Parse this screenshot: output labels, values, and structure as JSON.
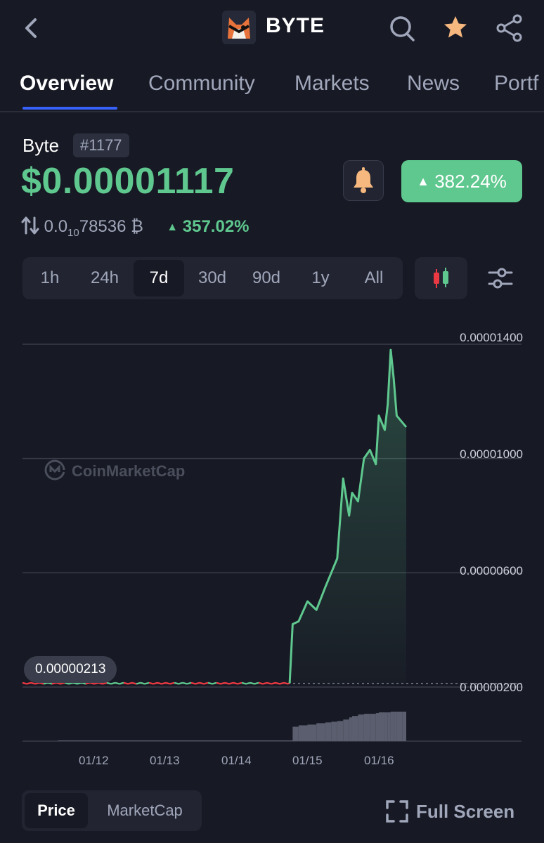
{
  "header": {
    "title": "BYTE",
    "back_icon": "chevron-left-icon",
    "search_icon": "search-icon",
    "star_icon": "star-icon",
    "share_icon": "share-icon",
    "star_color": "#f6b87e"
  },
  "tabs": [
    {
      "label": "Overview",
      "active": true
    },
    {
      "label": "Community",
      "active": false
    },
    {
      "label": "Markets",
      "active": false
    },
    {
      "label": "News",
      "active": false
    },
    {
      "label": "Portf",
      "active": false
    }
  ],
  "coin": {
    "name": "Byte",
    "rank": "#1177",
    "price": "$0.00001117",
    "change_24h": "382.24%",
    "btc_price_prefix": "0.0",
    "btc_price_subscript": "10",
    "btc_price_suffix": "78536 ₿",
    "btc_change": "357.02%"
  },
  "colors": {
    "up": "#5fc88f",
    "down": "#ea3943",
    "accent": "#3861fb",
    "bell": "#f6b87e"
  },
  "range": {
    "options": [
      "1h",
      "24h",
      "7d",
      "30d",
      "90d",
      "1y",
      "All"
    ],
    "selected": "7d"
  },
  "chart_data": {
    "type": "area",
    "title": "",
    "xlabel": "",
    "ylabel": "",
    "y_ticks": [
      "0.00001400",
      "0.00001000",
      "0.00000600",
      "0.00000200"
    ],
    "x_ticks": [
      "01/12",
      "01/13",
      "01/14",
      "01/15",
      "01/16"
    ],
    "ylim": [
      2e-06,
      1.4e-05
    ],
    "reference_price": "0.00000213",
    "watermark": "CoinMarketCap",
    "grid": true,
    "series": [
      {
        "x": [
          "01/11 12:00",
          "01/12 00:00",
          "01/12 12:00",
          "01/13 00:00",
          "01/13 12:00",
          "01/14 00:00",
          "01/14 12:00",
          "01/14 18:00",
          "01/14 19:00",
          "01/14 21:00",
          "01/15 00:00",
          "01/15 03:00",
          "01/15 06:00",
          "01/15 08:00",
          "01/15 10:00",
          "01/15 12:00",
          "01/15 14:00",
          "01/15 15:00",
          "01/15 17:00",
          "01/15 19:00",
          "01/15 21:00",
          "01/15 23:00",
          "01/16 00:00",
          "01/16 02:00",
          "01/16 03:00",
          "01/16 04:00",
          "01/16 05:00",
          "01/16 06:00",
          "01/16 08:00"
        ],
        "values": [
          2.13e-06,
          2.12e-06,
          2.13e-06,
          2.12e-06,
          2.13e-06,
          2.12e-06,
          2.13e-06,
          2.13e-06,
          4.2e-06,
          4.3e-06,
          5e-06,
          4.7e-06,
          5.5e-06,
          6e-06,
          6.5e-06,
          9.3e-06,
          8e-06,
          8.8e-06,
          8.5e-06,
          1e-05,
          1.03e-05,
          9.8e-06,
          1.15e-05,
          1.1e-05,
          1.19e-05,
          1.38e-05,
          1.28e-05,
          1.15e-05,
          1.11e-05
        ]
      }
    ],
    "volume": [
      1,
      1,
      1,
      1,
      1,
      1,
      1,
      1,
      20,
      22,
      23,
      25,
      26,
      27,
      28,
      30,
      33,
      35,
      37,
      38,
      38,
      39,
      40,
      40,
      40,
      41,
      41,
      41,
      41
    ]
  },
  "bottom": {
    "toggle": [
      "Price",
      "MarketCap"
    ],
    "toggle_selected": "Price",
    "fullscreen_label": "Full Screen",
    "fullscreen_icon": "expand-icon"
  }
}
